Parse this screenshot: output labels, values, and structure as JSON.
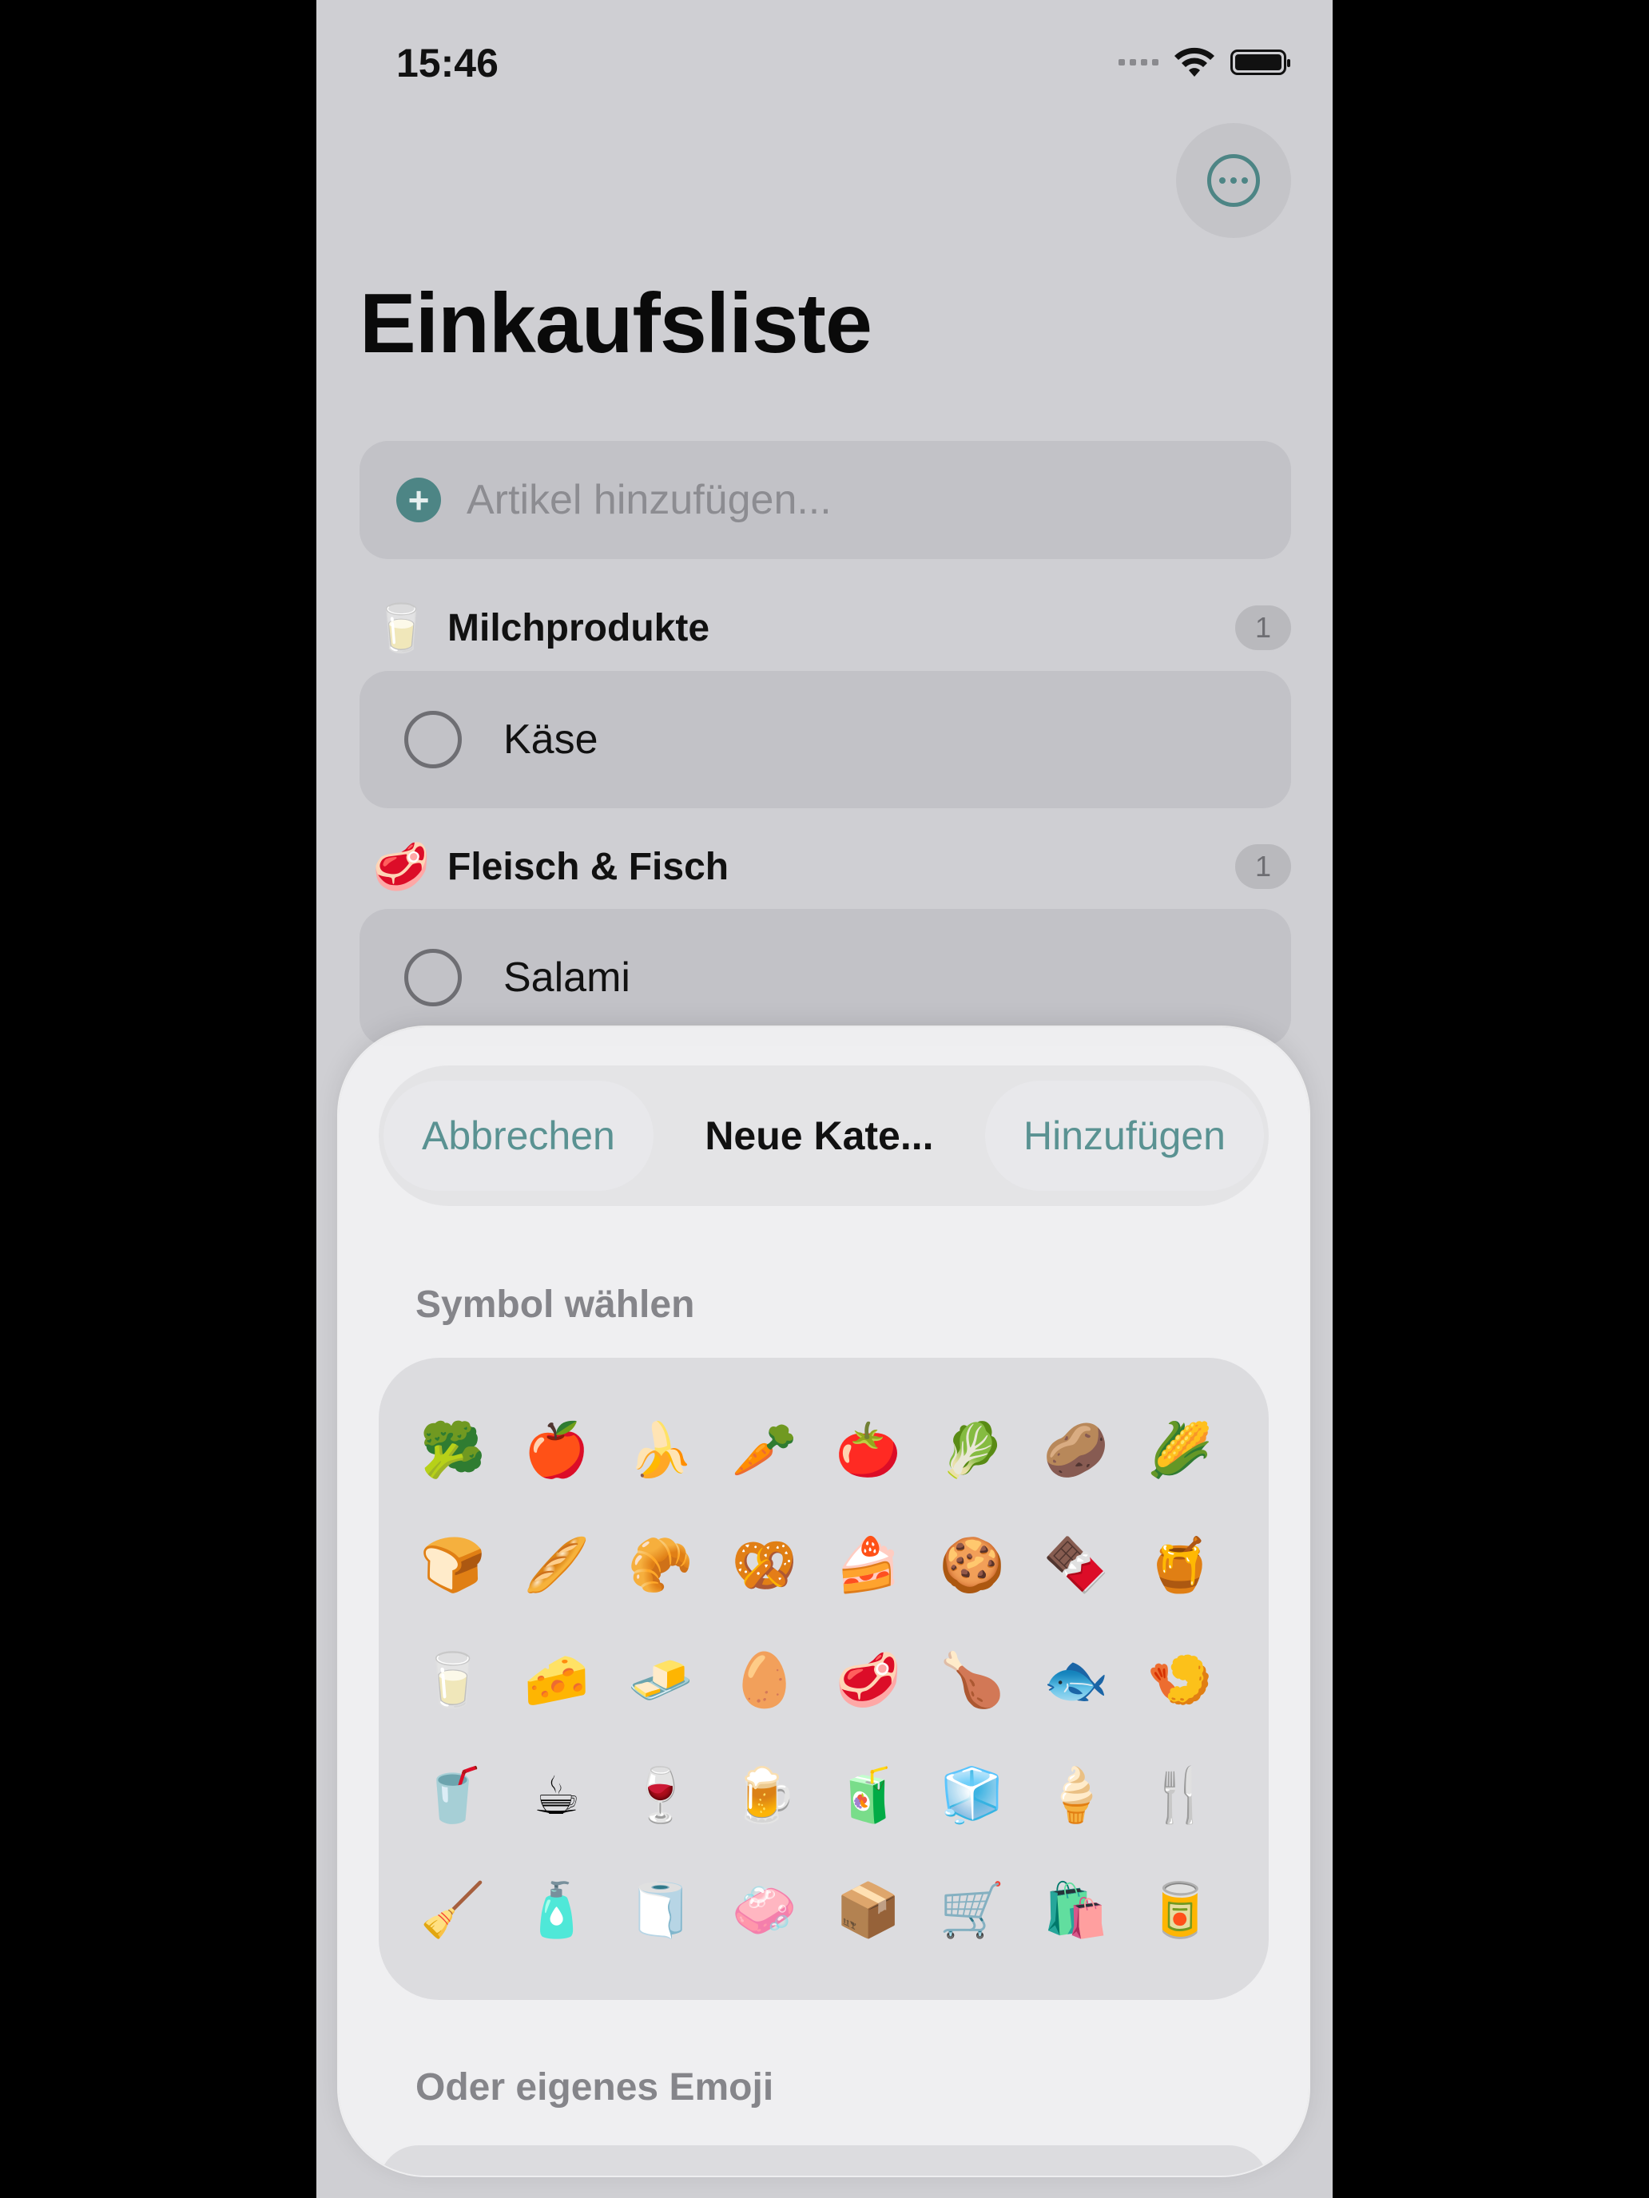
{
  "status_bar": {
    "time": "15:46"
  },
  "header": {
    "title": "Einkaufsliste",
    "more_icon": "ellipsis-circle-icon"
  },
  "add_item": {
    "placeholder": "Artikel hinzufügen...",
    "icon": "plus-circle-icon"
  },
  "categories": [
    {
      "emoji": "🥛",
      "name": "Milchprodukte",
      "count": "1",
      "items": [
        "Käse"
      ]
    },
    {
      "emoji": "🥩",
      "name": "Fleisch & Fisch",
      "count": "1",
      "items": [
        "Salami"
      ]
    }
  ],
  "sheet": {
    "cancel_label": "Abbrechen",
    "title": "Neue Kate...",
    "add_label": "Hinzufügen",
    "symbol_section_label": "Symbol wählen",
    "custom_section_label": "Oder eigenes Emoji",
    "emojis": [
      "🥦",
      "🍎",
      "🍌",
      "🥕",
      "🍅",
      "🥬",
      "🥔",
      "🌽",
      "🍞",
      "🥖",
      "🥐",
      "🥨",
      "🍰",
      "🍪",
      "🍫",
      "🍯",
      "🥛",
      "🧀",
      "🧈",
      "🥚",
      "🥩",
      "🍗",
      "🐟",
      "🍤",
      "🥤",
      "☕",
      "🍷",
      "🍺",
      "🧃",
      "🧊",
      "🍦",
      "🍴",
      "🧹",
      "🧴",
      "🧻",
      "🧼",
      "📦",
      "🛒",
      "🛍️",
      "🥫"
    ]
  },
  "colors": {
    "accent": "#4d8585",
    "background": "#cfcfd3"
  }
}
